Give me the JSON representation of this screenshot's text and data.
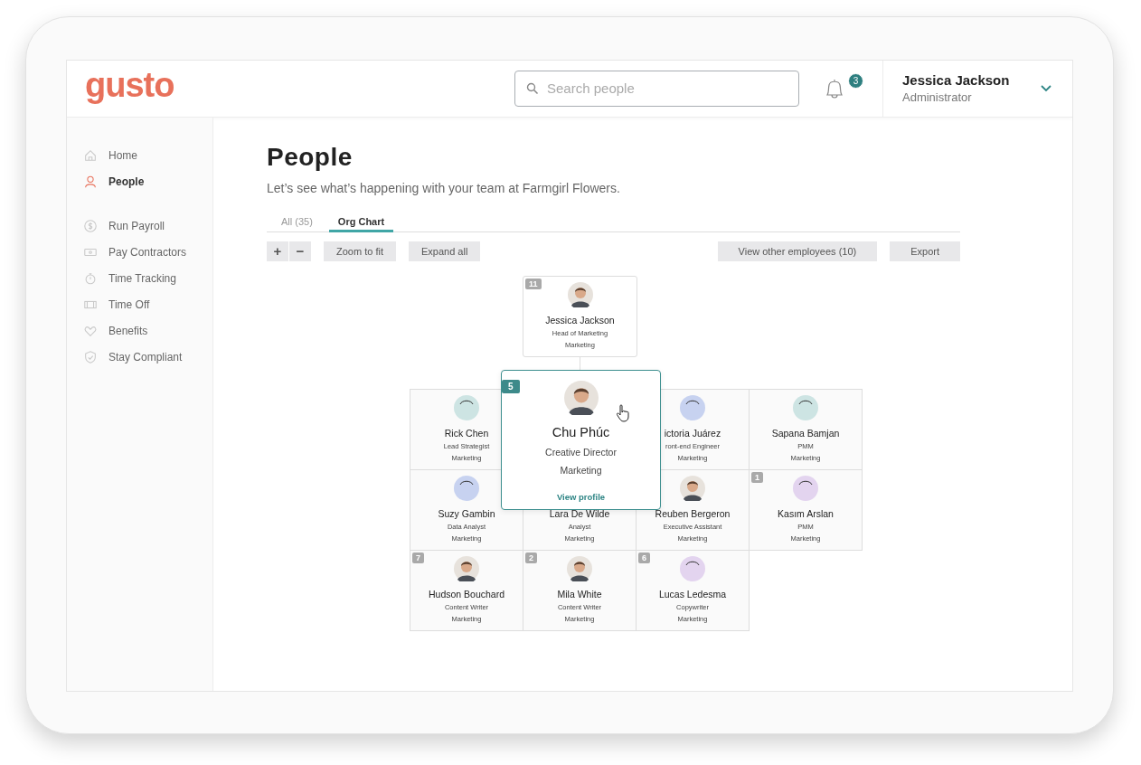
{
  "logo": "gusto",
  "search": {
    "placeholder": "Search people"
  },
  "notifications": {
    "count": "3"
  },
  "user": {
    "name": "Jessica Jackson",
    "role": "Administrator"
  },
  "sidebar": {
    "groups": [
      [
        {
          "label": "Home",
          "kind": "home",
          "selected": false
        },
        {
          "label": "People",
          "kind": "person",
          "selected": true
        }
      ],
      [
        {
          "label": "Run Payroll",
          "kind": "dollar",
          "selected": false
        },
        {
          "label": "Pay Contractors",
          "kind": "cash",
          "selected": false
        },
        {
          "label": "Time Tracking",
          "kind": "stopwatch",
          "selected": false
        },
        {
          "label": "Time Off",
          "kind": "ticket",
          "selected": false
        },
        {
          "label": "Benefits",
          "kind": "heart",
          "selected": false
        },
        {
          "label": "Stay Compliant",
          "kind": "shield",
          "selected": false
        }
      ]
    ]
  },
  "page": {
    "title": "People",
    "subtitle": "Let’s see what’s happening with your team at Farmgirl Flowers.",
    "tabs": [
      {
        "label": "All (35)",
        "selected": false
      },
      {
        "label": "Org Chart",
        "selected": true
      }
    ],
    "toolbar": {
      "zoom_in": "+",
      "zoom_out": "−",
      "left": [
        "Zoom to fit",
        "Expand all"
      ],
      "right": [
        "View other employees (10)",
        "Export"
      ]
    }
  },
  "org_chart": {
    "root": {
      "count": "11",
      "kind": "photo",
      "name": "Jessica Jackson",
      "title": "Head of Marketing",
      "department": "Marketing"
    },
    "reports": [
      {
        "kind": "illustration",
        "color": "#cde4e3",
        "name": "Rick Chen",
        "title": "Lead Strategist",
        "department": "Marketing",
        "hovered": false
      },
      {
        "kind": "photo",
        "count": "5",
        "name": "Chu Phúc",
        "title": "Creative Director",
        "department": "Marketing",
        "link": "View profile",
        "hovered": true
      },
      {
        "kind": "illustration",
        "color": "#c7d2f0",
        "name": "ictoria Juárez",
        "title": "ront-end Engineer",
        "department": "Marketing",
        "hovered": false
      },
      {
        "kind": "illustration",
        "color": "#cde4e3",
        "name": "Sapana Bamjan",
        "title": "PMM",
        "department": "Marketing",
        "hovered": false
      },
      {
        "kind": "illustration",
        "color": "#c7d2f0",
        "name": "Suzy Gambin",
        "title": "Data Analyst",
        "department": "Marketing",
        "hovered": false
      },
      {
        "name": "Lara De Wilde",
        "title": "Analyst",
        "department": "Marketing",
        "hovered": false
      },
      {
        "kind": "photo",
        "name": "Reuben Bergeron",
        "title": "Executive Assistant",
        "department": "Marketing",
        "hovered": false
      },
      {
        "kind": "illustration",
        "color": "#e3d4ef",
        "count": "1",
        "name": "Kasım Arslan",
        "title": "PMM",
        "department": "Marketing",
        "hovered": false
      },
      {
        "kind": "photo",
        "count": "7",
        "name": "Hudson Bouchard",
        "title": "Content Writer",
        "department": "Marketing",
        "hovered": false
      },
      {
        "kind": "photo",
        "count": "2",
        "name": "Mila White",
        "title": "Content Writer",
        "department": "Marketing",
        "hovered": false
      },
      {
        "kind": "illustration",
        "color": "#e3d4ef",
        "count": "6",
        "name": "Lucas Ledesma",
        "title": "Copywriter",
        "department": "Marketing",
        "hovered": false
      }
    ]
  }
}
